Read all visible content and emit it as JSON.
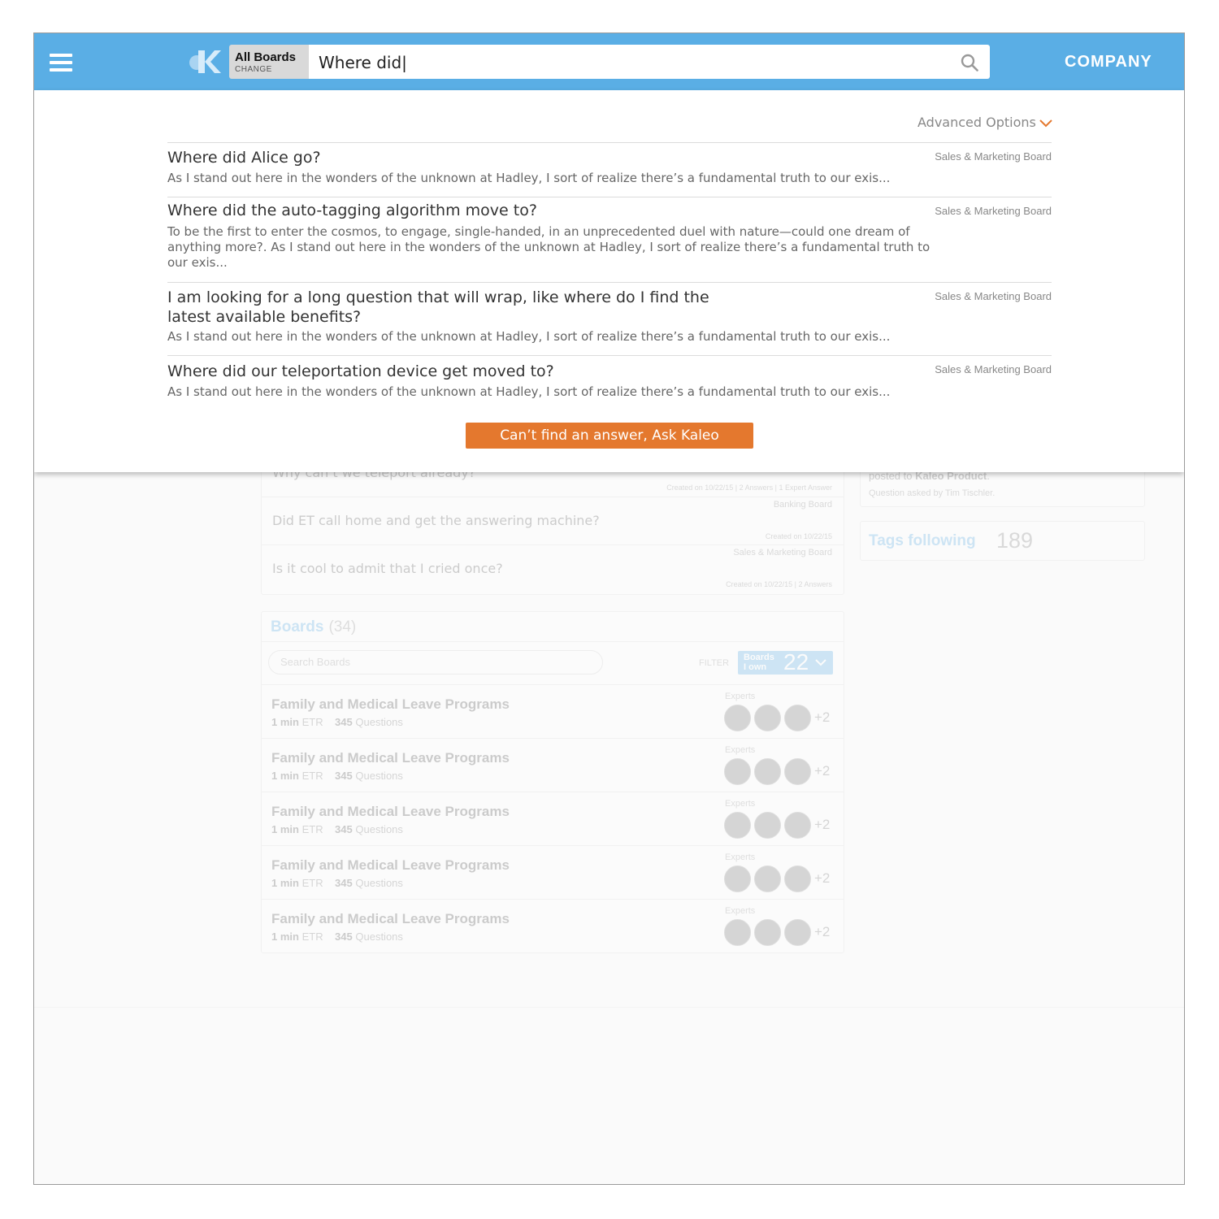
{
  "header": {
    "board_label": "All Boards",
    "board_change": "CHANGE",
    "search_value": "Where did|",
    "company": "COMPANY",
    "colors": {
      "header_bg": "#5aaee5",
      "accent": "#e4782e"
    }
  },
  "dropdown": {
    "advanced_label": "Advanced Options",
    "results": [
      {
        "title": "Where did Alice go?",
        "board": "Sales & Marketing Board",
        "excerpt": "As I stand out here in the wonders of the unknown at Hadley, I sort of realize there’s a fundamental truth to our exis..."
      },
      {
        "title": "Where did the auto-tagging algorithm move to?",
        "board": "Sales & Marketing Board",
        "excerpt": "To be the first to enter the cosmos, to engage, single-handed, in an unprecedented duel with nature—could one dream of anything more?. As I stand out here in the wonders of the unknown at Hadley, I sort of realize there’s a fundamental truth to our exis..."
      },
      {
        "title": "I am looking for a long question that will wrap, like where do I find the latest available benefits?",
        "board": "Sales & Marketing Board",
        "excerpt": "As I stand out here in the wonders of the unknown at Hadley, I sort of realize there’s a fundamental truth to our exis..."
      },
      {
        "title": "Where did our teleportation device get moved to?",
        "board": "Sales & Marketing Board",
        "excerpt": "As I stand out here in the wonders of the unknown at Hadley, I sort of realize there’s a fundamental truth to our exis..."
      }
    ],
    "ask_button": "Can’t find an answer, Ask Kaleo"
  },
  "background": {
    "questions": [
      {
        "title": "Why can’t we teleport already?",
        "board": "",
        "meta": "Created on 10/22/15  |  2 Answers  |  1 Expert Answer"
      },
      {
        "title": "Did ET call home and get the answering machine?",
        "board": "Banking Board",
        "meta": "Created on 10/22/15"
      },
      {
        "title": "Is it cool to admit that I cried once?",
        "board": "Sales & Marketing Board",
        "meta": "Created on 10/22/15  |  2 Answers"
      }
    ],
    "boards": {
      "title": "Boards",
      "count": "(34)",
      "search_placeholder": "Search Boards",
      "filter_label": "FILTER",
      "filter_pill_line1": "Boards",
      "filter_pill_line2": "I own",
      "filter_count": "22",
      "rows": [
        {
          "name": "Family and Medical Leave Programs",
          "etr_value": "1 min",
          "etr_label": "ETR",
          "q_value": "345",
          "q_label": "Questions",
          "experts": "Experts",
          "more": "+2"
        },
        {
          "name": "Family and Medical Leave Programs",
          "etr_value": "1 min",
          "etr_label": "ETR",
          "q_value": "345",
          "q_label": "Questions",
          "experts": "Experts",
          "more": "+2"
        },
        {
          "name": "Family and Medical Leave Programs",
          "etr_value": "1 min",
          "etr_label": "ETR",
          "q_value": "345",
          "q_label": "Questions",
          "experts": "Experts",
          "more": "+2"
        },
        {
          "name": "Family and Medical Leave Programs",
          "etr_value": "1 min",
          "etr_label": "ETR",
          "q_value": "345",
          "q_label": "Questions",
          "experts": "Experts",
          "more": "+2"
        },
        {
          "name": "Family and Medical Leave Programs",
          "etr_value": "1 min",
          "etr_label": "ETR",
          "q_value": "345",
          "q_label": "Questions",
          "experts": "Experts",
          "more": "+2"
        }
      ]
    },
    "right": {
      "posted_prefix": "posted to",
      "posted_board": "Kaleo Product",
      "asked_by": "Question asked by Tim Tischler.",
      "tags_title": "Tags following",
      "tags_count": "189"
    }
  }
}
